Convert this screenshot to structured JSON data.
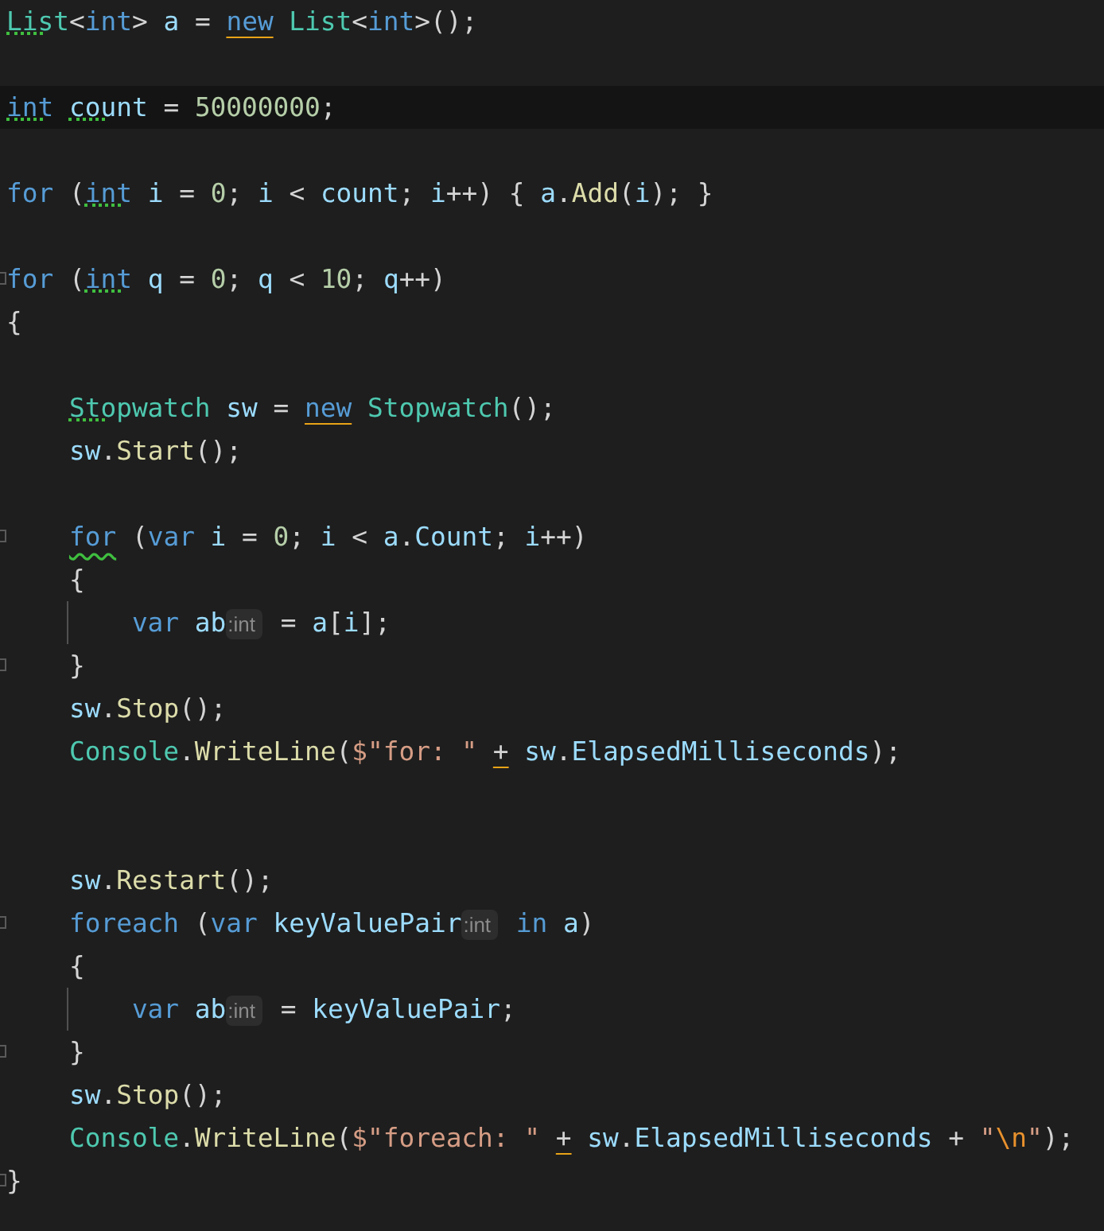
{
  "editor": {
    "lines": [
      {
        "kind": "code",
        "tokens": [
          {
            "text": "List",
            "kind": "type",
            "hint": true
          },
          {
            "text": "<",
            "kind": "plain"
          },
          {
            "text": "int",
            "kind": "keyword"
          },
          {
            "text": "> ",
            "kind": "plain"
          },
          {
            "text": "a",
            "kind": "variable"
          },
          {
            "text": " = ",
            "kind": "plain"
          },
          {
            "text": "new",
            "kind": "keyword",
            "suggestion": true
          },
          {
            "text": " List",
            "kind": "type"
          },
          {
            "text": "<",
            "kind": "plain"
          },
          {
            "text": "int",
            "kind": "keyword"
          },
          {
            "text": ">();",
            "kind": "plain"
          }
        ]
      },
      {
        "kind": "blank"
      },
      {
        "kind": "code",
        "current": true,
        "tokens": [
          {
            "text": "int ",
            "kind": "keyword",
            "hint": true
          },
          {
            "text": "count",
            "kind": "variable",
            "hint": true
          },
          {
            "text": " = ",
            "kind": "plain"
          },
          {
            "text": "50000000",
            "kind": "number"
          },
          {
            "text": ";",
            "kind": "plain"
          }
        ]
      },
      {
        "kind": "blank"
      },
      {
        "kind": "code",
        "tokens": [
          {
            "text": "for",
            "kind": "keyword"
          },
          {
            "text": " (",
            "kind": "plain"
          },
          {
            "text": "int",
            "kind": "keyword",
            "hint": true
          },
          {
            "text": " i",
            "kind": "variable"
          },
          {
            "text": " = ",
            "kind": "plain"
          },
          {
            "text": "0",
            "kind": "number"
          },
          {
            "text": "; ",
            "kind": "plain"
          },
          {
            "text": "i",
            "kind": "variable"
          },
          {
            "text": " < ",
            "kind": "plain"
          },
          {
            "text": "count",
            "kind": "variable"
          },
          {
            "text": "; ",
            "kind": "plain"
          },
          {
            "text": "i",
            "kind": "variable"
          },
          {
            "text": "++) { ",
            "kind": "plain"
          },
          {
            "text": "a",
            "kind": "variable"
          },
          {
            "text": ".",
            "kind": "plain"
          },
          {
            "text": "Add",
            "kind": "method"
          },
          {
            "text": "(",
            "kind": "plain"
          },
          {
            "text": "i",
            "kind": "variable"
          },
          {
            "text": "); }",
            "kind": "plain"
          }
        ]
      },
      {
        "kind": "blank"
      },
      {
        "kind": "code",
        "fold": true,
        "tokens": [
          {
            "text": "for",
            "kind": "keyword"
          },
          {
            "text": " (",
            "kind": "plain"
          },
          {
            "text": "int",
            "kind": "keyword",
            "hint": true
          },
          {
            "text": " q",
            "kind": "variable"
          },
          {
            "text": " = ",
            "kind": "plain"
          },
          {
            "text": "0",
            "kind": "number"
          },
          {
            "text": "; ",
            "kind": "plain"
          },
          {
            "text": "q",
            "kind": "variable"
          },
          {
            "text": " < ",
            "kind": "plain"
          },
          {
            "text": "10",
            "kind": "number"
          },
          {
            "text": "; ",
            "kind": "plain"
          },
          {
            "text": "q",
            "kind": "variable"
          },
          {
            "text": "++)",
            "kind": "plain"
          }
        ]
      },
      {
        "kind": "code",
        "tokens": [
          {
            "text": "{",
            "kind": "plain"
          }
        ],
        "children": [
          {
            "kind": "blank"
          },
          {
            "kind": "code",
            "tokens": [
              {
                "text": "Stopwatch",
                "kind": "type",
                "hint": true
              },
              {
                "text": " sw",
                "kind": "variable"
              },
              {
                "text": " = ",
                "kind": "plain"
              },
              {
                "text": "new",
                "kind": "keyword",
                "suggestion": true
              },
              {
                "text": " Stopwatch",
                "kind": "type"
              },
              {
                "text": "();",
                "kind": "plain"
              }
            ]
          },
          {
            "kind": "code",
            "tokens": [
              {
                "text": "sw",
                "kind": "variable"
              },
              {
                "text": ".",
                "kind": "plain"
              },
              {
                "text": "Start",
                "kind": "method"
              },
              {
                "text": "();",
                "kind": "plain"
              }
            ]
          },
          {
            "kind": "blank"
          },
          {
            "kind": "code",
            "fold": true,
            "tokens": [
              {
                "text": "for",
                "kind": "keyword",
                "warning": true
              },
              {
                "text": " (",
                "kind": "plain"
              },
              {
                "text": "var",
                "kind": "keyword"
              },
              {
                "text": " i",
                "kind": "variable"
              },
              {
                "text": " = ",
                "kind": "plain"
              },
              {
                "text": "0",
                "kind": "number"
              },
              {
                "text": "; ",
                "kind": "plain"
              },
              {
                "text": "i",
                "kind": "variable"
              },
              {
                "text": " < ",
                "kind": "plain"
              },
              {
                "text": "a",
                "kind": "variable"
              },
              {
                "text": ".",
                "kind": "plain"
              },
              {
                "text": "Count",
                "kind": "variable"
              },
              {
                "text": "; ",
                "kind": "plain"
              },
              {
                "text": "i",
                "kind": "variable"
              },
              {
                "text": "++)",
                "kind": "plain"
              }
            ]
          },
          {
            "kind": "code",
            "tokens": [
              {
                "text": "{",
                "kind": "plain"
              }
            ],
            "children": [
              {
                "kind": "code",
                "guide": true,
                "tokens": [
                  {
                    "text": "var",
                    "kind": "keyword"
                  },
                  {
                    "text": " ab",
                    "kind": "variable"
                  },
                  {
                    "text": ":int",
                    "kind": "inlay"
                  },
                  {
                    "text": " = ",
                    "kind": "plain"
                  },
                  {
                    "text": "a",
                    "kind": "variable"
                  },
                  {
                    "text": "[",
                    "kind": "plain"
                  },
                  {
                    "text": "i",
                    "kind": "variable"
                  },
                  {
                    "text": "];",
                    "kind": "plain"
                  }
                ]
              }
            ]
          },
          {
            "kind": "code",
            "fold": true,
            "tokens": [
              {
                "text": "}",
                "kind": "plain"
              }
            ]
          },
          {
            "kind": "code",
            "tokens": [
              {
                "text": "sw",
                "kind": "variable"
              },
              {
                "text": ".",
                "kind": "plain"
              },
              {
                "text": "Stop",
                "kind": "method"
              },
              {
                "text": "();",
                "kind": "plain"
              }
            ]
          },
          {
            "kind": "code",
            "tokens": [
              {
                "text": "Console",
                "kind": "type"
              },
              {
                "text": ".",
                "kind": "plain"
              },
              {
                "text": "WriteLine",
                "kind": "method"
              },
              {
                "text": "(",
                "kind": "plain"
              },
              {
                "text": "$\"for: \" ",
                "kind": "string"
              },
              {
                "text": "+",
                "kind": "plain",
                "suggestion": true
              },
              {
                "text": " sw",
                "kind": "variable"
              },
              {
                "text": ".",
                "kind": "plain"
              },
              {
                "text": "ElapsedMilliseconds",
                "kind": "variable"
              },
              {
                "text": ");",
                "kind": "plain"
              }
            ]
          },
          {
            "kind": "blank"
          },
          {
            "kind": "blank"
          },
          {
            "kind": "code",
            "tokens": [
              {
                "text": "sw",
                "kind": "variable"
              },
              {
                "text": ".",
                "kind": "plain"
              },
              {
                "text": "Restart",
                "kind": "method"
              },
              {
                "text": "();",
                "kind": "plain"
              }
            ]
          },
          {
            "kind": "code",
            "fold": true,
            "tokens": [
              {
                "text": "foreach",
                "kind": "keyword"
              },
              {
                "text": " (",
                "kind": "plain"
              },
              {
                "text": "var",
                "kind": "keyword"
              },
              {
                "text": " keyValuePair",
                "kind": "variable"
              },
              {
                "text": ":int",
                "kind": "inlay"
              },
              {
                "text": " in",
                "kind": "keyword"
              },
              {
                "text": " a",
                "kind": "variable"
              },
              {
                "text": ")",
                "kind": "plain"
              }
            ]
          },
          {
            "kind": "code",
            "tokens": [
              {
                "text": "{",
                "kind": "plain"
              }
            ],
            "children": [
              {
                "kind": "code",
                "guide": true,
                "tokens": [
                  {
                    "text": "var",
                    "kind": "keyword"
                  },
                  {
                    "text": " ab",
                    "kind": "variable"
                  },
                  {
                    "text": ":int",
                    "kind": "inlay"
                  },
                  {
                    "text": " = ",
                    "kind": "plain"
                  },
                  {
                    "text": "keyValuePair",
                    "kind": "variable"
                  },
                  {
                    "text": ";",
                    "kind": "plain"
                  }
                ]
              }
            ]
          },
          {
            "kind": "code",
            "fold": true,
            "tokens": [
              {
                "text": "}",
                "kind": "plain"
              }
            ]
          },
          {
            "kind": "code",
            "tokens": [
              {
                "text": "sw",
                "kind": "variable"
              },
              {
                "text": ".",
                "kind": "plain"
              },
              {
                "text": "Stop",
                "kind": "method"
              },
              {
                "text": "();",
                "kind": "plain"
              }
            ]
          },
          {
            "kind": "code",
            "tokens": [
              {
                "text": "Console",
                "kind": "type"
              },
              {
                "text": ".",
                "kind": "plain"
              },
              {
                "text": "WriteLine",
                "kind": "method"
              },
              {
                "text": "(",
                "kind": "plain"
              },
              {
                "text": "$\"foreach: \" ",
                "kind": "string"
              },
              {
                "text": "+",
                "kind": "plain",
                "suggestion": true
              },
              {
                "text": " sw",
                "kind": "variable"
              },
              {
                "text": ".",
                "kind": "plain"
              },
              {
                "text": "ElapsedMilliseconds",
                "kind": "variable"
              },
              {
                "text": " + ",
                "kind": "plain"
              },
              {
                "text": "\"",
                "kind": "string"
              },
              {
                "text": "\\n",
                "kind": "escape"
              },
              {
                "text": "\"",
                "kind": "string"
              },
              {
                "text": ");",
                "kind": "plain"
              }
            ]
          }
        ]
      },
      {
        "kind": "code",
        "fold": true,
        "tokens": [
          {
            "text": "}",
            "kind": "plain"
          }
        ]
      }
    ]
  }
}
